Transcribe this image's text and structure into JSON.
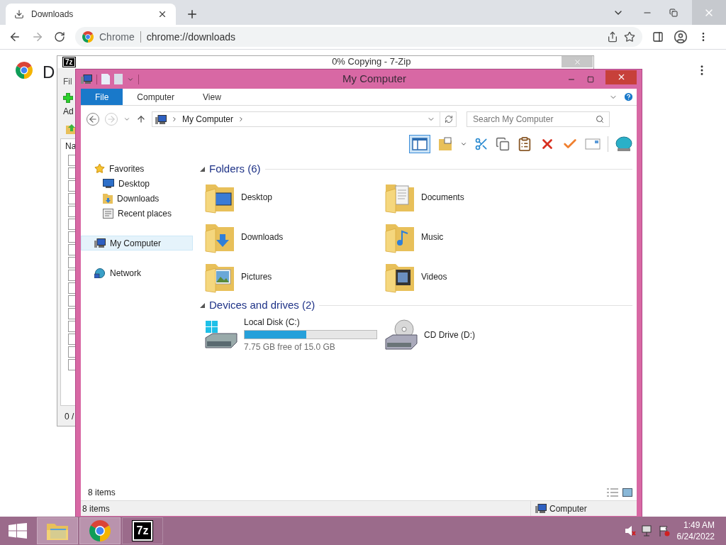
{
  "browser": {
    "tab": {
      "title": "Downloads"
    },
    "omnibox": {
      "site_label": "Chrome",
      "url": "chrome://downloads"
    },
    "page": {
      "heading": "D"
    }
  },
  "zip_window": {
    "icon_text": "7z",
    "title": "0% Copying - 7-Zip",
    "menu": "Fil",
    "toolbar_label": "Ad",
    "column_header": "Na",
    "status": "0 /"
  },
  "explorer": {
    "title": "My Computer",
    "ribbon_tabs": [
      {
        "label": "File",
        "selected": true
      },
      {
        "label": "Computer",
        "selected": false
      },
      {
        "label": "View",
        "selected": false
      }
    ],
    "breadcrumb": "My Computer",
    "search": {
      "placeholder": "Search My Computer"
    },
    "nav": [
      {
        "label": "Favorites",
        "kind": "favorites",
        "selected": false,
        "children": [
          {
            "label": "Desktop",
            "kind": "desktop",
            "selected": false
          },
          {
            "label": "Downloads",
            "kind": "downloads",
            "selected": false
          },
          {
            "label": "Recent places",
            "kind": "recent",
            "selected": false
          }
        ]
      },
      {
        "label": "My Computer",
        "kind": "computer",
        "selected": true
      },
      {
        "label": "Network",
        "kind": "network",
        "selected": false
      }
    ],
    "groups": [
      {
        "title": "Folders (6)",
        "items": [
          {
            "name": "Desktop",
            "kind": "desktop"
          },
          {
            "name": "Documents",
            "kind": "documents"
          },
          {
            "name": "Downloads",
            "kind": "downloads"
          },
          {
            "name": "Music",
            "kind": "music"
          },
          {
            "name": "Pictures",
            "kind": "pictures"
          },
          {
            "name": "Videos",
            "kind": "videos"
          }
        ]
      },
      {
        "title": "Devices and drives (2)",
        "items": [
          {
            "name": "Local Disk (C:)",
            "kind": "disk",
            "level": 0.47,
            "free": "7.75 GB free of 15.0 GB"
          },
          {
            "name": "CD Drive (D:)",
            "kind": "cd"
          }
        ]
      }
    ],
    "item_count": "8 items",
    "status_bar": {
      "count": "8 items",
      "location": "Computer"
    }
  },
  "taskbar": {
    "apps": [
      {
        "kind": "explorer",
        "selected": true
      },
      {
        "kind": "chrome",
        "selected": true
      },
      {
        "kind": "zip",
        "label": "7z",
        "selected": false
      }
    ],
    "clock": {
      "time": "1:49 AM",
      "date": "6/24/2022"
    }
  }
}
